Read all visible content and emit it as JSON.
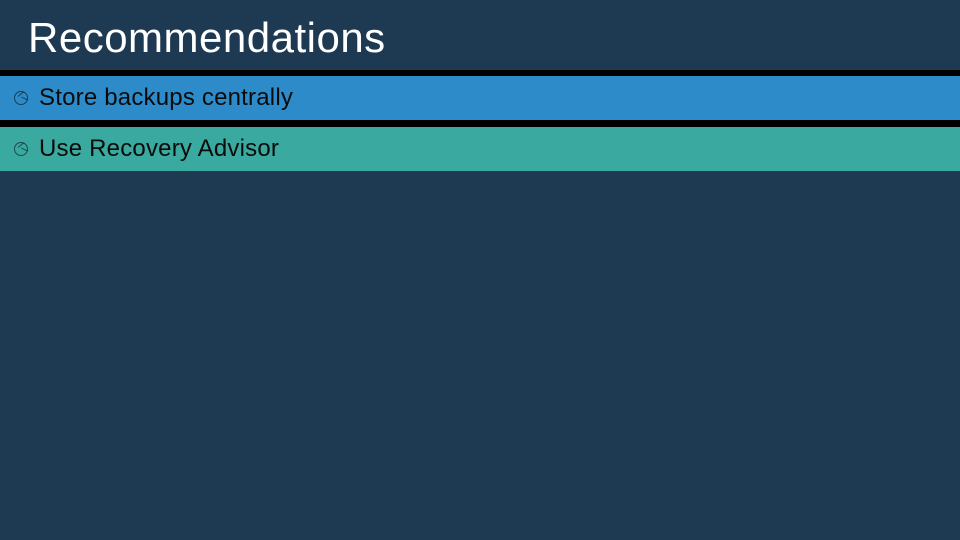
{
  "slide": {
    "title": "Recommendations",
    "items": [
      {
        "label": "Store backups centrally",
        "color": "#2e8bc9"
      },
      {
        "label": "Use Recovery Advisor",
        "color": "#3aa99f"
      }
    ]
  }
}
